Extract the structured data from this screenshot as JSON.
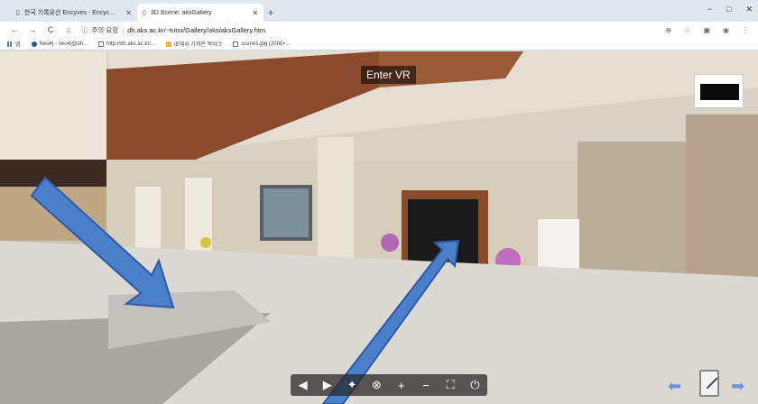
{
  "browser": {
    "tabs": [
      {
        "title": "한국 기록유산 Encyves - Encyc...",
        "active": false
      },
      {
        "title": "3D Scene: aksGallery",
        "active": true
      }
    ],
    "new_tab": "+",
    "window_controls": [
      "−",
      "□",
      "✕"
    ],
    "omnibox": {
      "security": "주의 요함",
      "url": "dh.aks.ac.kr/~tutor/Gallery/aks/aksGallery.htm"
    },
    "bookmarks": [
      {
        "label": "앱",
        "icon": "apps-icon"
      },
      {
        "label": "Neo4j - neo4j@dh...",
        "icon": "neo4j-icon"
      },
      {
        "label": "http://dh.aks.ac.kr/...",
        "icon": "page-icon"
      },
      {
        "label": "IE에서 가져온 북마크",
        "icon": "folder-icon"
      },
      {
        "label": "scene1.jpg (2000×...",
        "icon": "page-icon"
      }
    ]
  },
  "scene": {
    "enter_vr": "Enter VR",
    "controls": [
      "◀",
      "▶",
      "✦",
      "⊗",
      "+",
      "−",
      "⛶",
      "⏻"
    ]
  },
  "colors": {
    "arrow": "#4a7fc9",
    "nav_arrow": "#6f8fd8"
  }
}
